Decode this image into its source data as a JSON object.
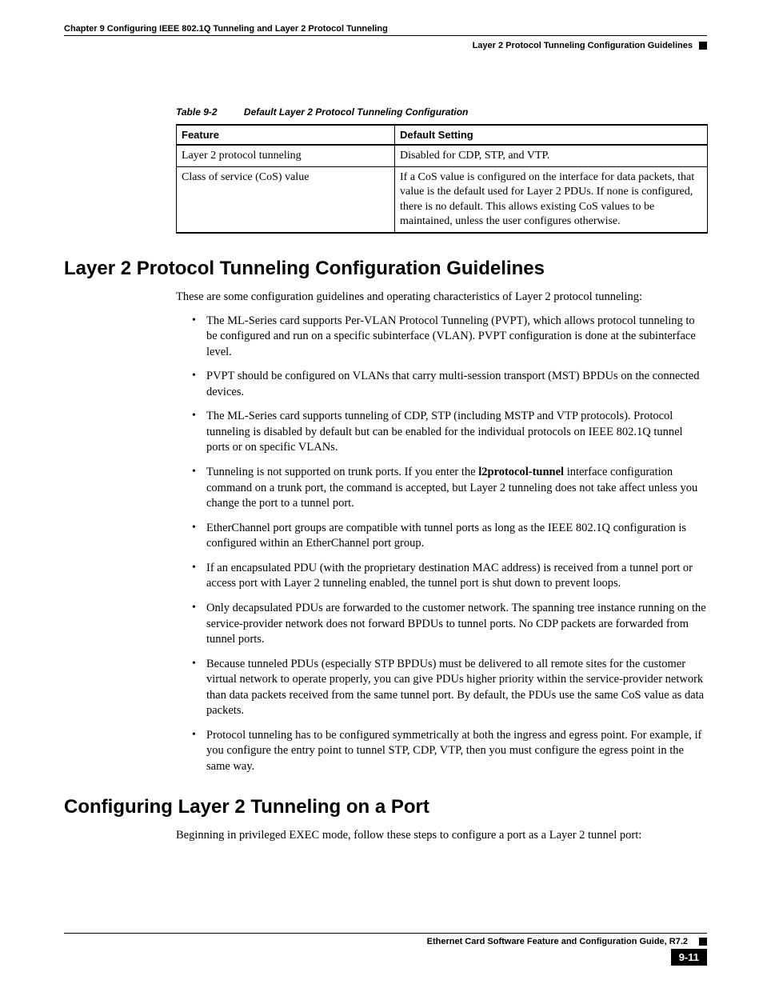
{
  "header": {
    "chapter_line": "Chapter 9   Configuring IEEE 802.1Q Tunneling and Layer 2 Protocol Tunneling",
    "section_line": "Layer 2 Protocol Tunneling Configuration Guidelines"
  },
  "table": {
    "label": "Table 9-2",
    "title": "Default Layer 2 Protocol Tunneling Configuration",
    "headers": {
      "col1": "Feature",
      "col2": "Default Setting"
    },
    "rows": [
      {
        "feature": "Layer 2 protocol tunneling",
        "setting": "Disabled for CDP, STP, and VTP."
      },
      {
        "feature": "Class of service (CoS) value",
        "setting": "If a CoS value is configured on the interface for data packets, that value is the default used for Layer 2 PDUs. If none is configured, there is no default. This allows existing CoS values to be maintained, unless the user configures otherwise."
      }
    ]
  },
  "section1": {
    "heading": "Layer 2 Protocol Tunneling Configuration Guidelines",
    "intro": "These are some configuration guidelines and operating characteristics of Layer 2 protocol tunneling:",
    "bullets": [
      "The ML-Series card supports Per-VLAN Protocol Tunneling (PVPT), which allows protocol tunneling to be configured and run on a specific subinterface (VLAN). PVPT configuration is done at the subinterface level.",
      "PVPT should be configured on VLANs that carry multi-session transport (MST) BPDUs on the connected devices.",
      "The ML-Series card supports tunneling of CDP, STP (including MSTP and VTP protocols). Protocol tunneling is disabled by default but can be enabled for the individual protocols on IEEE 802.1Q tunnel ports or on specific VLANs.",
      {
        "pre": "Tunneling is not supported on trunk ports. If you enter the ",
        "boldcmd": "l2protocol-tunnel",
        "post": " interface configuration command on a trunk port, the command is accepted, but Layer 2 tunneling does not take affect unless you change the port to a tunnel port."
      },
      "EtherChannel port groups are compatible with tunnel ports as long as the IEEE 802.1Q configuration is configured within an EtherChannel port group.",
      "If an encapsulated PDU (with the proprietary destination MAC address) is received from a tunnel port or access port with Layer 2 tunneling enabled, the tunnel port is shut down to prevent loops.",
      "Only decapsulated PDUs are forwarded to the customer network. The spanning tree instance running on the service-provider network does not forward BPDUs to tunnel ports. No CDP packets are forwarded from tunnel ports.",
      "Because tunneled PDUs (especially STP BPDUs) must be delivered to all remote sites for the customer virtual network to operate properly, you can give PDUs higher priority within the service-provider network than data packets received from the same tunnel port. By default, the PDUs use the same CoS value as data packets.",
      "Protocol tunneling has to be configured symmetrically at both the ingress and egress point. For example, if you configure the entry point to tunnel STP, CDP, VTP, then you must configure the egress point in the same way."
    ]
  },
  "section2": {
    "heading": "Configuring Layer 2 Tunneling on a Port",
    "intro": "Beginning in privileged EXEC mode, follow these steps to configure a port as a Layer 2 tunnel port:"
  },
  "footer": {
    "guide_title": "Ethernet Card Software Feature and Configuration Guide, R7.2",
    "page_number": "9-11"
  }
}
